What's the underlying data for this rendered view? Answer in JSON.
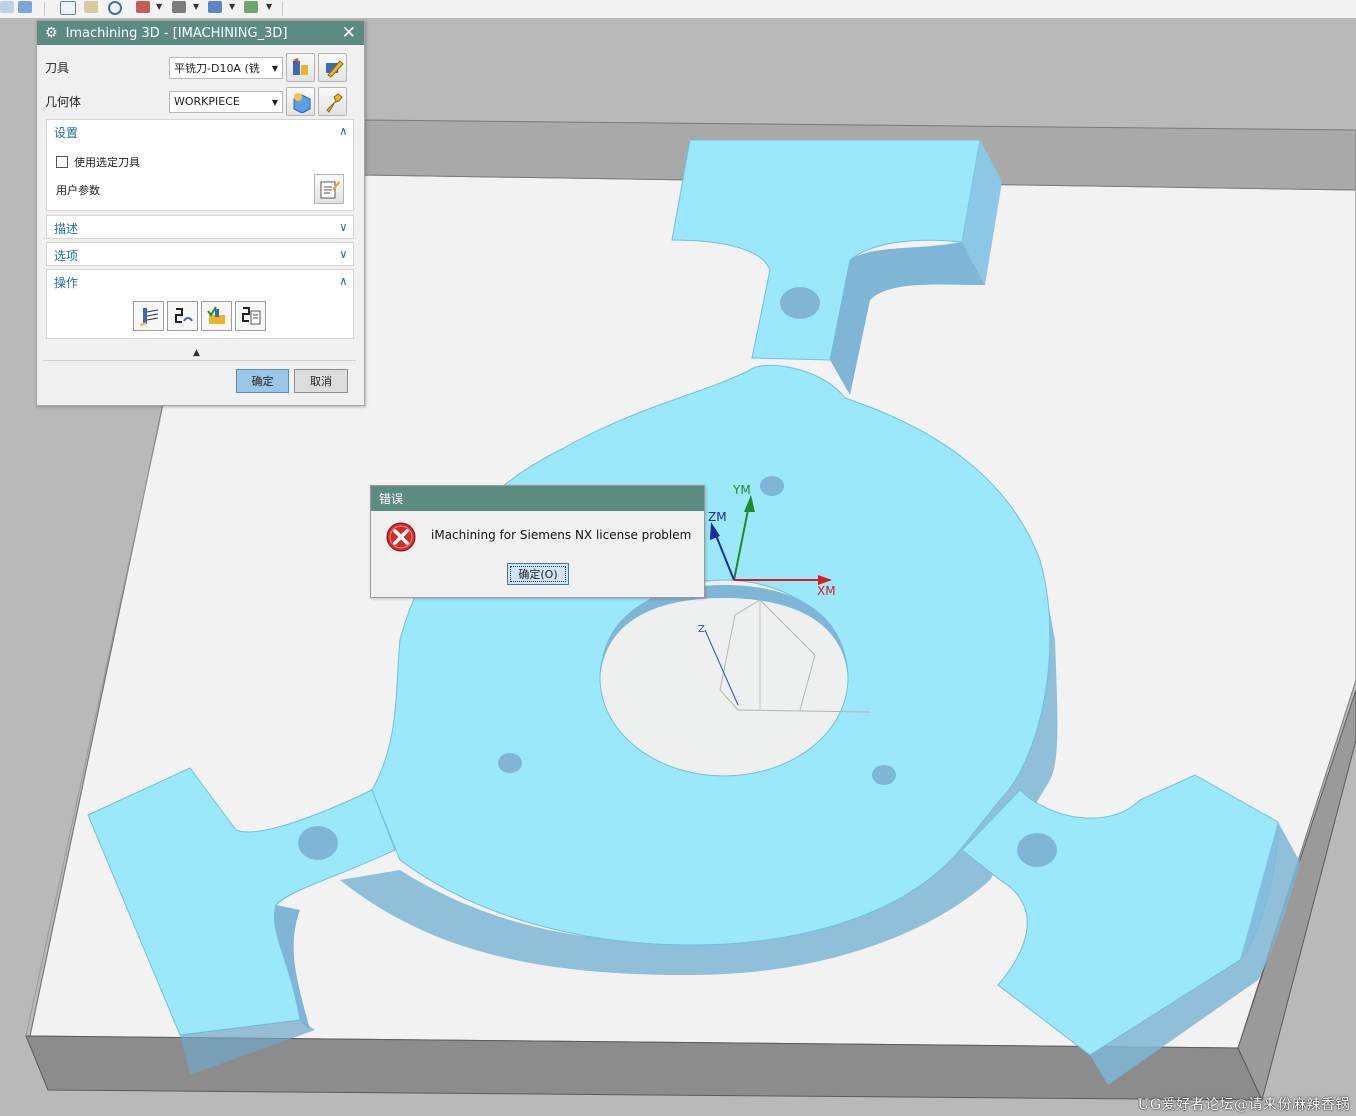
{
  "toolbar": {
    "icons": [
      "cube-icon",
      "fit-view-icon",
      "zoom-window-icon",
      "rotate-icon",
      "layer-icon",
      "render-style-icon",
      "view-orient-icon",
      "filter-icon"
    ]
  },
  "viewport": {
    "axis_labels": {
      "ym": "YM",
      "zm": "ZM",
      "xm": "XM",
      "z": "Z"
    },
    "colors": {
      "part": "#9be8fb",
      "part_edge": "#6fbfe0",
      "stock": "#f4f4f4",
      "background": "#b9b9b9"
    },
    "watermark": "UG爱好者论坛@请来份麻辣香锅"
  },
  "dialog": {
    "title": "Imachining 3D - [IMACHINING_3D]",
    "tool": {
      "label": "刀具",
      "value": "平铣刀-D10A (铣"
    },
    "geometry": {
      "label": "几何体",
      "value": "WORKPIECE"
    },
    "groups": {
      "settings": {
        "label": "设置",
        "checkbox_label": "使用选定刀具",
        "user_params_label": "用户参数"
      },
      "description": {
        "label": "描述"
      },
      "options": {
        "label": "选项"
      },
      "actions": {
        "label": "操作"
      }
    },
    "ok_label": "确定",
    "cancel_label": "取消"
  },
  "error_dialog": {
    "title": "错误",
    "message": "iMachining for Siemens NX license problem",
    "ok_label": "确定(O)"
  }
}
